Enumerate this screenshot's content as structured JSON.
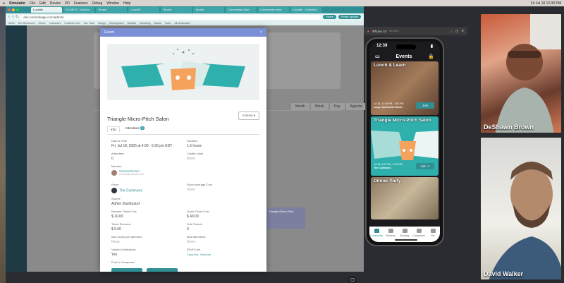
{
  "menubar": {
    "app": "Simulator",
    "items": [
      "File",
      "Edit",
      "Device",
      "I/O",
      "Features",
      "Debug",
      "Window",
      "Help"
    ],
    "right": [
      "Fri Jul 18  12:30 PM"
    ]
  },
  "browser": {
    "tabs": [
      "Lunalite",
      "GLOBOT - Dashbo",
      "Tenant",
      "LunaOS",
      "Tenant",
      "Tenant",
      "Community Dash",
      "Community ment",
      "Lunalite - Overview"
    ],
    "address": "dev.commnkapp.com/admin/",
    "share_label": "Share",
    "update_label": "Finish update",
    "bookmarks": [
      "Mesh",
      "Dev Resources",
      "Admin",
      "Customers",
      "Customer Dev",
      "Dev Tools",
      "Design",
      "Development",
      "Website",
      "Marketing",
      "Mobile",
      "Team",
      "All Bookmarks"
    ]
  },
  "background": {
    "view_tabs": [
      "Month",
      "Week",
      "Day",
      "Agenda"
    ],
    "event_label": "Triangle Micro-Pitch"
  },
  "modal": {
    "header": "Event",
    "close": "×",
    "title": "Triangle Micro-Pitch Salon",
    "actions": "Actions ▾",
    "tabs": {
      "info": "Info",
      "attendees": "Attendees",
      "attendees_count": "0"
    },
    "fields": {
      "date_label": "Date & Time",
      "date_value": "Fri, Jul 18, 2025 at 4:00 - 5:30 pm EDT",
      "duration_label": "Duration",
      "duration_value": "1.5 hours",
      "attendees_label": "Attendees",
      "attendees_value": "0",
      "credits_label": "Credits Used",
      "credits_value": "None",
      "member_label": "Member",
      "member_name": "Vincent Brown",
      "member_email": "vincent@example.com",
      "room_label": "Room",
      "room_value": "The Commons",
      "room_cost_label": "Room Average Cost",
      "room_cost_value": "None",
      "source_label": "Source",
      "source_value": "Admin Dashboard",
      "member_ticket_label": "Member Ticket Cost",
      "member_ticket_value": "$ 10.00",
      "guest_ticket_label": "Guest Ticket Cost",
      "guest_ticket_value": "$ 40.00",
      "revenue_label": "Ticket Revenue",
      "revenue_value": "$ 0.00",
      "sold_label": "Sold Tickets",
      "sold_value": "0",
      "max_per_label": "Max tickets per attendee",
      "max_per_value": "None",
      "max_att_label": "Max Attendees",
      "max_att_value": "None",
      "visible_label": "Visible to Webstore",
      "visible_value": "Yes",
      "rsvp_label": "RSVP Link",
      "rsvp_copy": "Copy link",
      "rsvp_view": "View link",
      "post_label": "Post to Campuses"
    }
  },
  "simulator": {
    "title": "iPhone 15",
    "subtitle": "iOS 18.0"
  },
  "phone": {
    "time": "12:39",
    "nav_title": "Events",
    "events": [
      {
        "title": "Lunch & Learn",
        "time": "Jul 18, 12:00 PM - 1:00 PM",
        "place": "Large Conference Room",
        "button": "Join"
      },
      {
        "title": "Triangle Micro-Pitch Salon",
        "time": "Jul 18, 4:00 PM - 5:30 PM",
        "place": "The Commons",
        "button": "Join"
      },
      {
        "title": "Dinner Party",
        "time": "",
        "place": "",
        "button": ""
      }
    ],
    "tabs": [
      "Community",
      "Directory",
      "Booking",
      "Companies",
      "Me"
    ]
  },
  "video": [
    {
      "name": "DeShawn Brown"
    },
    {
      "name": "David Walker"
    }
  ],
  "colors": {
    "brand": "#2f8f94",
    "modal_header": "#7b8fd6"
  }
}
